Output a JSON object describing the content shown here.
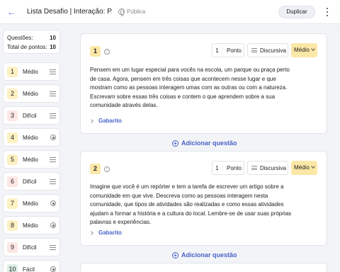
{
  "header": {
    "title": "Lista Desafio | Interação: P...",
    "visibility": "Pública",
    "duplicate_label": "Duplicar"
  },
  "summary": {
    "questions_label": "Questões:",
    "questions_value": "10",
    "points_label": "Total de pontos:",
    "points_value": "10"
  },
  "sidebar": {
    "items": [
      {
        "num": "1",
        "level": "Médio",
        "type": "lines-icon"
      },
      {
        "num": "2",
        "level": "Médio",
        "type": "lines-icon"
      },
      {
        "num": "3",
        "level": "Difícil",
        "type": "lines-icon"
      },
      {
        "num": "4",
        "level": "Médio",
        "type": "radio-icon"
      },
      {
        "num": "5",
        "level": "Médio",
        "type": "lines-icon"
      },
      {
        "num": "6",
        "level": "Difícil",
        "type": "lines-icon"
      },
      {
        "num": "7",
        "level": "Médio",
        "type": "radio-icon"
      },
      {
        "num": "8",
        "level": "Médio",
        "type": "radio-icon"
      },
      {
        "num": "9",
        "level": "Difícil",
        "type": "lines-icon"
      },
      {
        "num": "10",
        "level": "Fácil",
        "type": "radio-icon"
      }
    ]
  },
  "questions": [
    {
      "num": "1",
      "points_value": "1",
      "points_unit": "Ponto",
      "type": "Discursiva",
      "difficulty": "Médio",
      "text": "Pensem em um lugar especial para vocês na escola, um parque ou praça perto de casa. Agora, pensem em três coisas que acontecem nesse lugar e que mostram como as pessoas interagem umas com as outras ou com a natureza. Escrevam sobre essas três coisas e contem o que aprendem sobre a sua comunidade através delas.",
      "answer_label": "Gabarito"
    },
    {
      "num": "2",
      "points_value": "1",
      "points_unit": "Ponto",
      "type": "Discursiva",
      "difficulty": "Médio",
      "text": "Imagine que você é um repórter e tem a tarefa de escrever um artigo sobre a comunidade em que vive. Descreva como as pessoas interagem nesta comunidade, que tipos de atividades são realizadas e como essas atividades ajudam a formar a história e a cultura do local. Lembre-se de usar suas próprias palavras e experiências.",
      "answer_label": "Gabarito"
    }
  ],
  "add_question_label": "Adicionar questão"
}
